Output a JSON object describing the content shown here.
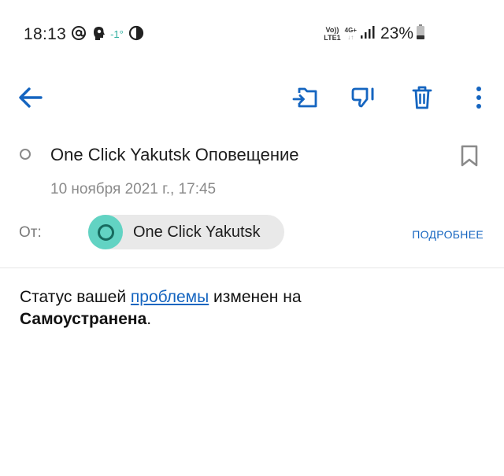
{
  "status_bar": {
    "time": "18:13",
    "temperature": "-1°",
    "volte_top": "Vo))",
    "volte_bottom": "LTE1",
    "network_top": "4G+",
    "network_arrows": "↓↑",
    "battery": "23%",
    "icons": [
      "at-icon",
      "head-icon",
      "contrast-icon",
      "signal-icon",
      "battery-icon"
    ]
  },
  "toolbar": {
    "icons": [
      "back-arrow-icon",
      "move-to-folder-icon",
      "spam-icon",
      "delete-icon",
      "more-vert-icon"
    ],
    "accent_color": "#1565c0"
  },
  "message": {
    "subject": "One Click Yakutsk Оповещение",
    "date": "10 ноября 2021 г., 17:45",
    "from_label": "От:",
    "sender_name": "One Click Yakutsk",
    "details_label": "ПОДРОБНЕЕ",
    "body_part1": "Статус вашей ",
    "body_link": "проблемы",
    "body_part2": " изменен на",
    "body_bold": "Самоустранена",
    "body_end": "."
  }
}
